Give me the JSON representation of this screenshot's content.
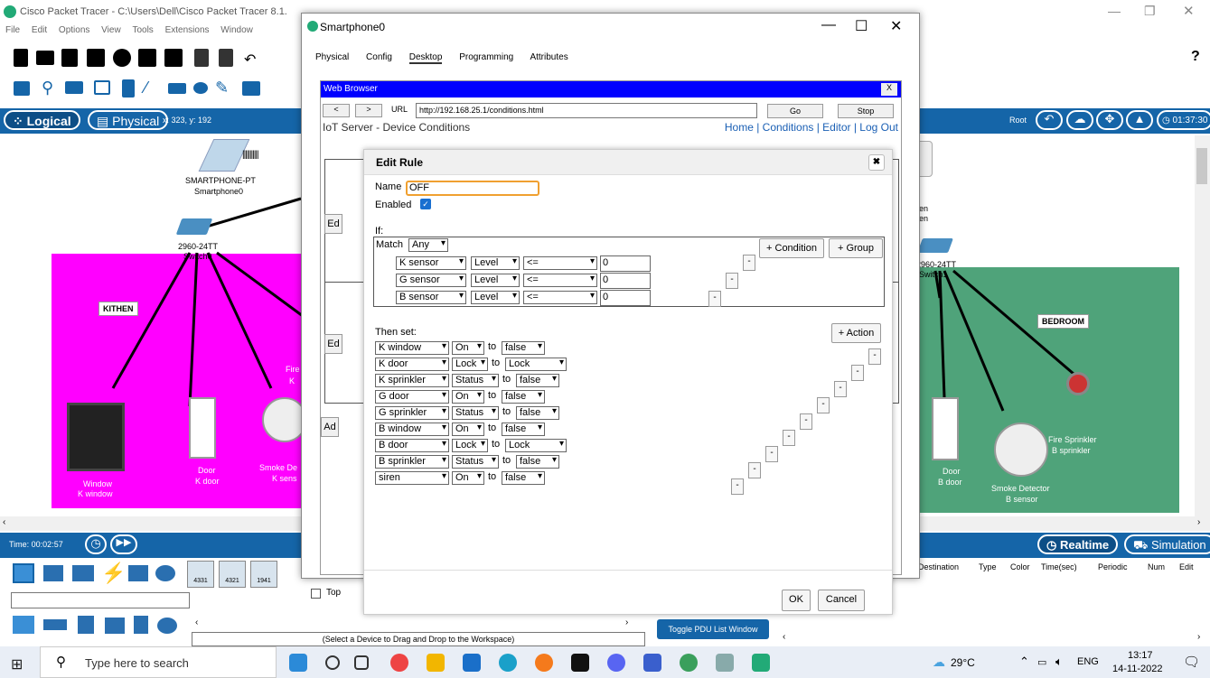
{
  "app": {
    "title": "Cisco Packet Tracer - C:\\Users\\Dell\\Cisco Packet Tracer 8.1.",
    "menu": [
      "File",
      "Edit",
      "Options",
      "View",
      "Tools",
      "Extensions",
      "Window"
    ],
    "help_glyph": "?"
  },
  "workspace_bar": {
    "logical": "Logical",
    "physical": "Physical",
    "coords": "x: 323, y: 192",
    "root": "Root",
    "clock": "01:37:30"
  },
  "canvas": {
    "phone_type": "SMARTPHONE-PT",
    "phone_name": "Smartphone0",
    "switch_label": "2960-24TT",
    "switch_name": "Switch0",
    "kitchen": "KITHEN",
    "bedroom": "BEDROOM",
    "k_window": [
      "Window",
      "K window"
    ],
    "k_door": [
      "Door",
      "K door"
    ],
    "k_smoke": [
      "Smoke De",
      "K sens"
    ],
    "k_fire": [
      "Fire",
      "K"
    ],
    "b_door": [
      "Door",
      "B door"
    ],
    "b_smoke": [
      "Smoke Detector",
      "B sensor"
    ],
    "b_sprinkler": [
      "Fire Sprinkler",
      "B sprinkler"
    ],
    "right_partial": [
      "en",
      "en"
    ],
    "right_switch": [
      "2960-24TT",
      "Switch1"
    ]
  },
  "timebar": {
    "time": "Time: 00:02:57",
    "realtime": "Realtime",
    "simulation": "Simulation"
  },
  "bottom": {
    "device_labels": [
      "4331",
      "4321",
      "1941"
    ],
    "hint": "(Select a Device to Drag and Drop to the Workspace)",
    "pdu_button": "Toggle PDU List Window",
    "pdu_cols": [
      "Destination",
      "Type",
      "Color",
      "Time(sec)",
      "Periodic",
      "Num",
      "Edit"
    ]
  },
  "phone": {
    "title": "Smartphone0",
    "tabs": [
      "Physical",
      "Config",
      "Desktop",
      "Programming",
      "Attributes"
    ],
    "active_tab": "Desktop",
    "top_label": "Top",
    "browser": {
      "title": "Web Browser",
      "close": "X",
      "back": "<",
      "fwd": ">",
      "url_label": "URL",
      "url": "http://192.168.25.1/conditions.html",
      "go": "Go",
      "stop": "Stop",
      "page_title": "IoT Server - Device Conditions",
      "links": "Home | Conditions | Editor | Log Out",
      "bg_buttons": [
        "Ed",
        "Ed",
        "Ad"
      ]
    },
    "edit_rule": {
      "title": "Edit Rule",
      "close": "✖",
      "name_label": "Name",
      "name_value": "OFF",
      "enabled_label": "Enabled",
      "if_label": "If:",
      "match_label": "Match",
      "match_value": "Any",
      "add_condition": "+ Condition",
      "add_group": "+ Group",
      "conditions": [
        {
          "device": "K sensor",
          "prop": "Level",
          "op": "<=",
          "value": "0"
        },
        {
          "device": "G sensor",
          "prop": "Level",
          "op": "<=",
          "value": "0"
        },
        {
          "device": "B sensor",
          "prop": "Level",
          "op": "<=",
          "value": "0"
        }
      ],
      "then_label": "Then set:",
      "add_action": "+ Action",
      "to": "to",
      "actions": [
        {
          "device": "K window",
          "prop": "On",
          "value": "false"
        },
        {
          "device": "K door",
          "prop": "Lock",
          "value": "Lock"
        },
        {
          "device": "K sprinkler",
          "prop": "Status",
          "value": "false"
        },
        {
          "device": "G door",
          "prop": "On",
          "value": "false"
        },
        {
          "device": "G sprinkler",
          "prop": "Status",
          "value": "false"
        },
        {
          "device": "B window",
          "prop": "On",
          "value": "false"
        },
        {
          "device": "B door",
          "prop": "Lock",
          "value": "Lock"
        },
        {
          "device": "B sprinkler",
          "prop": "Status",
          "value": "false"
        },
        {
          "device": "siren",
          "prop": "On",
          "value": "false"
        }
      ],
      "minus": "-",
      "ok": "OK",
      "cancel": "Cancel"
    }
  },
  "taskbar": {
    "search": "Type here to search",
    "weather": "29°C",
    "lang": "ENG",
    "time": "13:17",
    "date": "14-11-2022"
  }
}
